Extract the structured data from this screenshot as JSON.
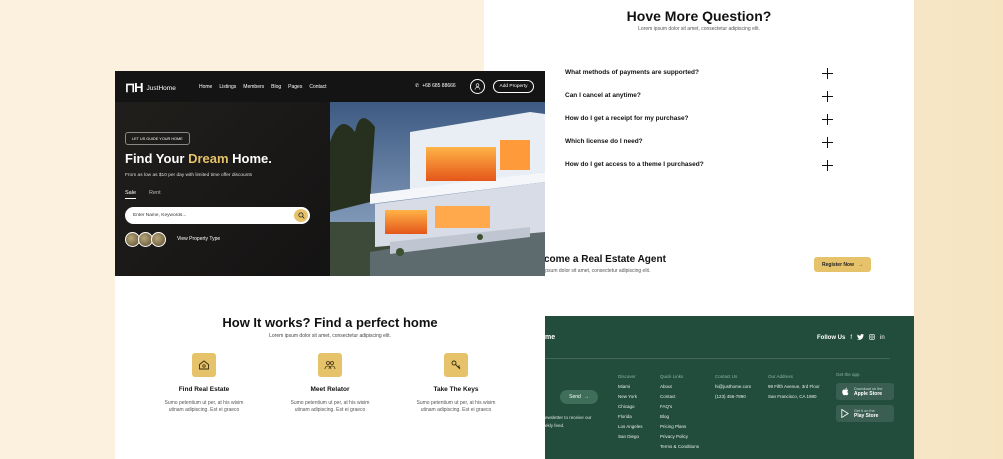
{
  "faq": {
    "title": "Hove More Question?",
    "subtitle": "Lorem ipsum dolor sit amet, consectetur adipiscing elit.",
    "questions": [
      "What methods of payments are supported?",
      "Can I cancel at anytime?",
      "How do I get a receipt for my purchase?",
      "Which license do I need?",
      "How do I get access to a theme I purchased?"
    ]
  },
  "agent": {
    "title": "come a Real Estate Agent",
    "subtitle": "n ipsum dolor sit amet, consectetur adipiscing elit.",
    "register_label": "Register Now",
    "register_icon": "arrow-right-icon"
  },
  "footer": {
    "brand": "me",
    "follow_label": "Follow Us",
    "social_icons": [
      "facebook-icon",
      "twitter-icon",
      "instagram-icon",
      "linkedin-icon"
    ],
    "send_label": "Send",
    "newsletter_line1": "ewsletter to receive our",
    "newsletter_line2": "ekly feed.",
    "discover": {
      "heading": "Discover",
      "items": [
        "Miami",
        "New York",
        "Chicago",
        "Florida",
        "Los Angeles",
        "San Diego"
      ]
    },
    "quick_links": {
      "heading": "Quick Links",
      "items": [
        "About",
        "Contact",
        "FAQ's",
        "Blog",
        "Pricing Plans",
        "Privacy Policy",
        "Terms & Conditions"
      ]
    },
    "contact": {
      "heading": "Contact Us",
      "email": "hi@justhome.com",
      "phone": "(123) 456-7890"
    },
    "address": {
      "heading": "Our Address",
      "line1": "99 Fifth Avenue, 3rd Floor",
      "line2": "San Francisco, CA 1980"
    },
    "get_app": "Get the app",
    "apple": {
      "small": "Download on the",
      "big": "Apple Store"
    },
    "play": {
      "small": "Get it on the",
      "big": "Play Store"
    }
  },
  "how": {
    "title": "How It works? Find a perfect home",
    "subtitle": "Lorem ipsum dolor sit amet, consectetur adipiscing elit.",
    "steps": [
      {
        "title": "Find Real Estate",
        "desc1": "Sumo petentium ut per, at his wisim",
        "desc2": "utinam adipiscing. Est ei graeco"
      },
      {
        "title": "Meet Relator",
        "desc1": "Sumo petentium ut per, at his wisim",
        "desc2": "utinam adipiscing. Est ei graeco"
      },
      {
        "title": "Take The Keys",
        "desc1": "Sumo petentium ut per, at his wisim",
        "desc2": "utinam adipiscing. Est ei graeco"
      }
    ]
  },
  "hero": {
    "brand": "JustHome",
    "nav": [
      "Home",
      "Listings",
      "Members",
      "Blog",
      "Pages",
      "Contact"
    ],
    "phone": "+68 685 88666",
    "add_property": "Add Property",
    "badge": "LET US GUIDE YOUR HOME",
    "title_pre": "Find Your ",
    "title_highlight": "Dream",
    "title_post": " Home.",
    "subtitle": "From as low as $10 per day with limited time offer discounts",
    "tabs": [
      "Sale",
      "Rent"
    ],
    "search_placeholder": "Enter Name, Keywords...",
    "view_type": "View Property Type"
  },
  "colors": {
    "accent": "#e6c36a",
    "footer_bg": "#224c3c",
    "hero_bg": "#151414"
  }
}
